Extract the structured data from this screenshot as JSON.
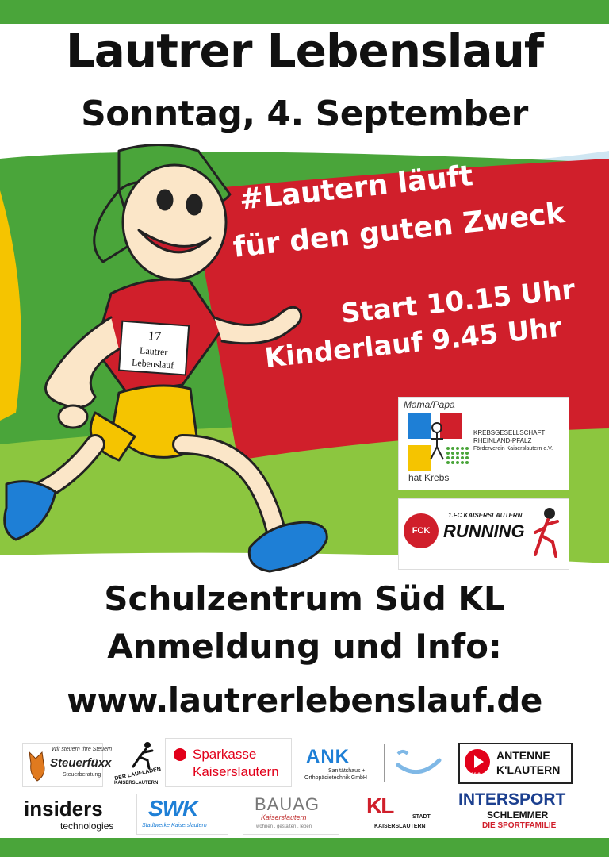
{
  "header": {
    "title": "Lautrer Lebenslauf",
    "date": "Sonntag, 4. September"
  },
  "runner": {
    "bib_number": "17",
    "bib_line1": "Lautrer",
    "bib_line2": "Lebenslauf"
  },
  "banner": {
    "line1": "#Lautern läuft",
    "line2": "für den guten Zweck",
    "line3": "Start 10.15 Uhr",
    "line4": "Kinderlauf 9.45 Uhr"
  },
  "partner_krebs": {
    "top": "Mama/Papa",
    "bottom": "hat Krebs",
    "org1": "Krebsgesellschaft",
    "org2": "Rheinland-Pfalz",
    "org3": "Förderverein Kaiserslautern e.V."
  },
  "partner_fck": {
    "top": "1.FC KAISERSLAUTERN",
    "word": "RUNNING",
    "badge": "FCK"
  },
  "info": {
    "location": "Schulzentrum Süd KL",
    "signup": "Anmeldung und Info:",
    "url": "www.lautrerlebenslauf.de"
  },
  "sponsors": {
    "steuerfuxx_small": "Wir steuern Ihre Steuern",
    "steuerfuxx_name": "Steuerfüxx",
    "steuerfuxx_sub": "Steuerberatung",
    "laufladen_name": "DER LAUFLADEN",
    "laufladen_city": "KAISERSLAUTERN",
    "sparkasse_line1": "Sparkasse",
    "sparkasse_line2": "Kaiserslautern",
    "ank_name": "ANK",
    "ank_line1": "Sanitätshaus +",
    "ank_line2": "Orthopädietechnik GmbH",
    "antenne_line1": "ANTENNE",
    "antenne_line2": "K'LAUTERN",
    "antenne_freq": "96.9",
    "insiders_name": "insiders",
    "insiders_sub": "technologies",
    "swk_name": "SWK",
    "swk_sub": "Stadtwerke Kaiserslautern",
    "bauag_name": "BAUAG",
    "bauag_script": "Kaiserslautern",
    "bauag_sub": "wohnen . gestalten . leben",
    "kl_mark": "KL",
    "kl_stadt": "STADT",
    "kl_city": "KAISERSLAUTERN",
    "intersport_name": "INTERSPORT",
    "intersport_line2": "SCHLEMMER",
    "intersport_line3": "DIE SPORTFAMILIE"
  },
  "colors": {
    "green": "#4aa53a",
    "red": "#d01f2b",
    "yellow": "#f5c400",
    "blue": "#1e7fd6"
  }
}
